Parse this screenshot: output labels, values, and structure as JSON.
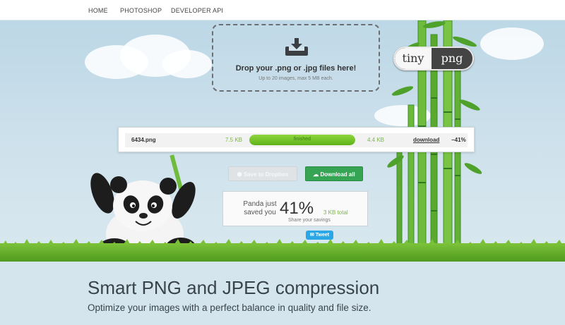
{
  "nav": {
    "items": [
      "HOME",
      "PHOTOSHOP",
      "DEVELOPER API"
    ]
  },
  "dropzone": {
    "icon": "download-tray-icon",
    "title": "Drop your .png or .jpg files here!",
    "subtitle": "Up to 20 images, max 5 MB each."
  },
  "logo": {
    "left": "tiny",
    "right": "png"
  },
  "file": {
    "name": "6434.png",
    "original_size": "7.5 KB",
    "status": "finished",
    "progress": 1.0,
    "new_size": "4.4 KB",
    "download_label": "download",
    "reduction": "−41%"
  },
  "buttons": {
    "dropbox": "Save to Dropbox",
    "download_all": "Download all",
    "tweet": "Tweet"
  },
  "savings": {
    "line1": "Panda just saved you",
    "percent": "41%",
    "total": "3 KB total",
    "share": "Share your savings"
  },
  "footer": {
    "headline": "Smart PNG and JPEG compression",
    "tagline": "Optimize your images with a perfect balance in quality and file size."
  },
  "colors": {
    "accent_green": "#35a554",
    "progress_green": "#7ec82d",
    "tweet_blue": "#2ba7e6",
    "text_dark": "#39434a"
  }
}
